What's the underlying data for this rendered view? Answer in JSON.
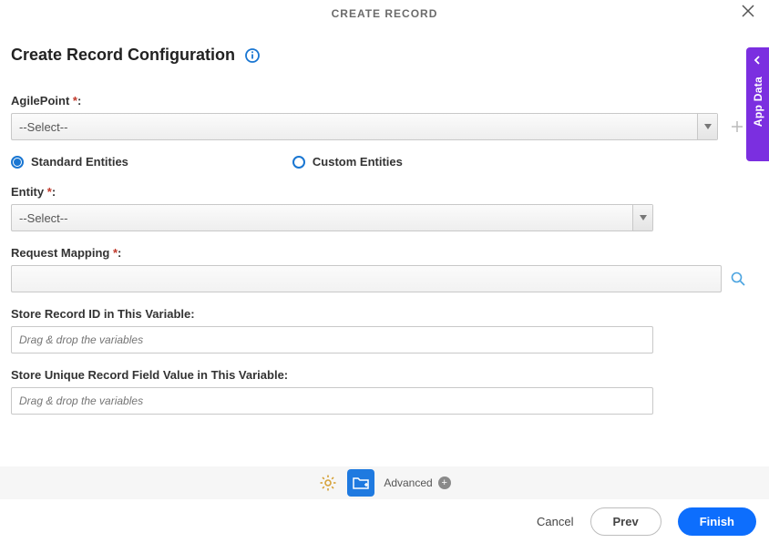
{
  "header": {
    "title": "CREATE RECORD"
  },
  "page": {
    "title": "Create Record Configuration",
    "agilepoint_label": "AgilePoint",
    "agilepoint_value": "--Select--",
    "radio_standard": "Standard Entities",
    "radio_custom": "Custom Entities",
    "entity_label": "Entity",
    "entity_value": "--Select--",
    "request_mapping_label": "Request Mapping",
    "store_record_label": "Store Record ID in This Variable:",
    "store_unique_label": "Store Unique Record Field Value in This Variable:",
    "drag_placeholder": "Drag & drop the variables"
  },
  "side_tab": {
    "label": "App Data"
  },
  "toolbar": {
    "advanced": "Advanced"
  },
  "footer": {
    "cancel": "Cancel",
    "prev": "Prev",
    "finish": "Finish"
  }
}
